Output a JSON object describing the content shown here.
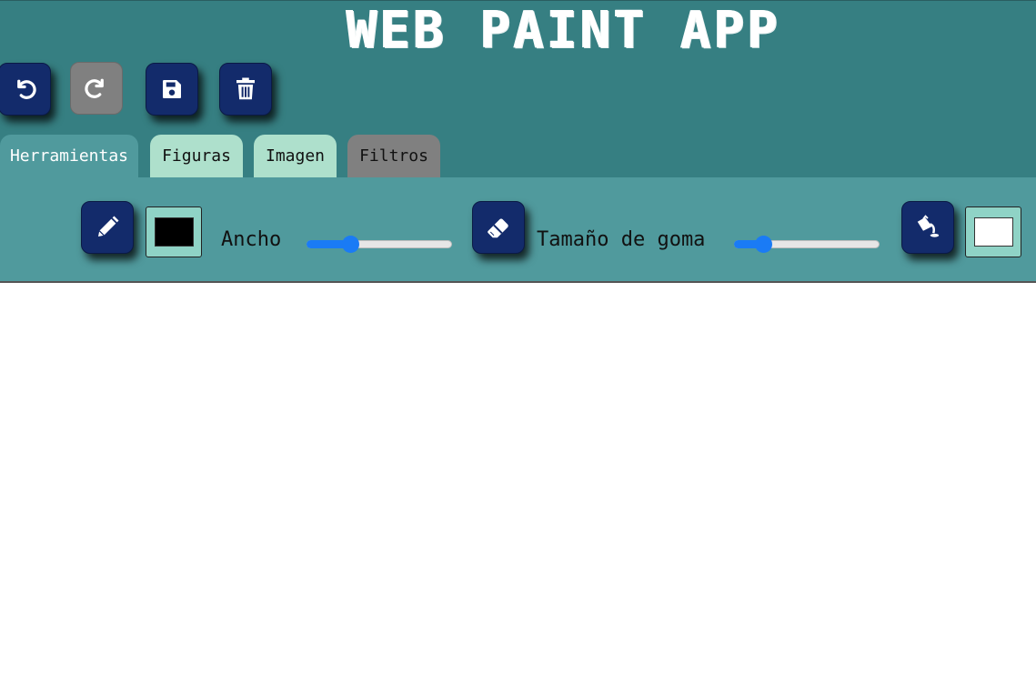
{
  "app": {
    "title": "WEB PAINT APP"
  },
  "actions": [
    {
      "name": "undo",
      "icon": "undo-icon",
      "enabled": true
    },
    {
      "name": "redo",
      "icon": "redo-icon",
      "enabled": false
    },
    {
      "name": "save",
      "icon": "floppy-disk-icon",
      "enabled": true
    },
    {
      "name": "clear",
      "icon": "trash-icon",
      "enabled": true
    }
  ],
  "tabs": [
    {
      "label": "Herramientas",
      "active": true
    },
    {
      "label": "Figuras",
      "active": false
    },
    {
      "label": "Imagen",
      "active": false
    },
    {
      "label": "Filtros",
      "active": false
    }
  ],
  "tools": {
    "pencil": {
      "icon": "pencil-icon",
      "color": "#000000"
    },
    "width": {
      "label": "Ancho",
      "value_fraction": 0.3
    },
    "eraser": {
      "icon": "eraser-icon",
      "size_label": "Tamaño de goma",
      "value_fraction": 0.2
    },
    "fill": {
      "icon": "paint-bucket-icon",
      "color": "#ffffff"
    }
  },
  "colors": {
    "header": "#367f82",
    "toolbar": "#509a9d",
    "button": "#132b6b",
    "button_disabled": "#808080",
    "tab_active": "#509a9d",
    "tab_inactive": "#aee0cc",
    "tab_disabled": "#808080",
    "slider_accent": "#1a7bf5"
  }
}
